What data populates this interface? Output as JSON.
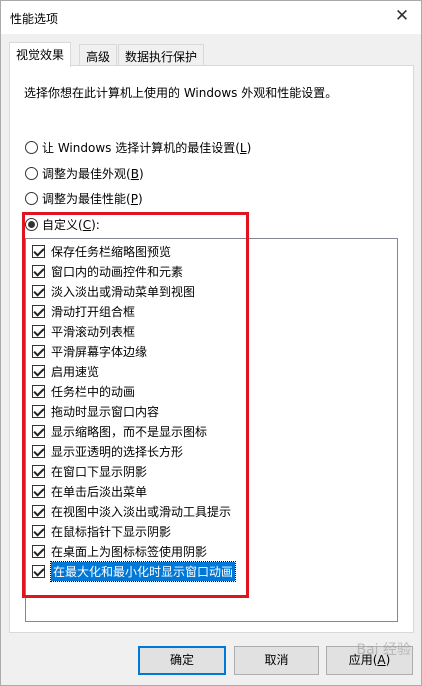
{
  "window": {
    "title": "性能选项",
    "close_symbol": "✕"
  },
  "tabs": [
    {
      "label": "视觉效果",
      "active": true
    },
    {
      "label": "高级",
      "active": false
    },
    {
      "label": "数据执行保护",
      "active": false
    }
  ],
  "visual_effects": {
    "description": "选择你想在此计算机上使用的 Windows 外观和性能设置。",
    "options": [
      {
        "label": "让 Windows 选择计算机的最佳设置",
        "accel": "L",
        "selected": false
      },
      {
        "label": "调整为最佳外观",
        "accel": "B",
        "selected": false
      },
      {
        "label": "调整为最佳性能",
        "accel": "P",
        "selected": false
      },
      {
        "label": "自定义",
        "accel": "C",
        "selected": true
      }
    ],
    "custom_colon": ":",
    "effects": [
      {
        "label": "保存任务栏缩略图预览",
        "checked": true
      },
      {
        "label": "窗口内的动画控件和元素",
        "checked": true
      },
      {
        "label": "淡入淡出或滑动菜单到视图",
        "checked": true
      },
      {
        "label": "滑动打开组合框",
        "checked": true
      },
      {
        "label": "平滑滚动列表框",
        "checked": true
      },
      {
        "label": "平滑屏幕字体边缘",
        "checked": true
      },
      {
        "label": "启用速览",
        "checked": true
      },
      {
        "label": "任务栏中的动画",
        "checked": true
      },
      {
        "label": "拖动时显示窗口内容",
        "checked": true
      },
      {
        "label": "显示缩略图，而不是显示图标",
        "checked": true
      },
      {
        "label": "显示亚透明的选择长方形",
        "checked": true
      },
      {
        "label": "在窗口下显示阴影",
        "checked": true
      },
      {
        "label": "在单击后淡出菜单",
        "checked": true
      },
      {
        "label": "在视图中淡入淡出或滑动工具提示",
        "checked": true
      },
      {
        "label": "在鼠标指针下显示阴影",
        "checked": true
      },
      {
        "label": "在桌面上为图标标签使用阴影",
        "checked": true
      },
      {
        "label": "在最大化和最小化时显示窗口动画",
        "checked": true,
        "selected": true
      }
    ]
  },
  "buttons": {
    "ok": "确定",
    "cancel": "取消",
    "apply_prefix": "应用(",
    "apply_accel": "A",
    "apply_suffix": ")"
  },
  "watermark": "Bai 经验",
  "colors": {
    "highlight_box": "#e0141e",
    "selection": "#0078d7"
  }
}
